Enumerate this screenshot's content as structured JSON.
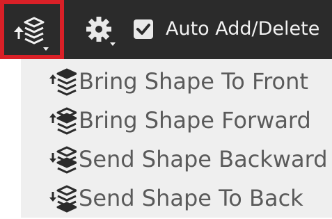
{
  "toolbar": {
    "layers_button_icon": "layers-arrange-icon",
    "settings_button_icon": "gear-icon",
    "auto_add_checkbox_checked": true,
    "auto_add_label": "Auto Add/Delete",
    "highlight_color": "#d92027",
    "background_color": "#2b2b2b"
  },
  "menu": {
    "items": [
      {
        "label": "Bring Shape To Front",
        "icon": "bring-to-front-icon"
      },
      {
        "label": "Bring Shape Forward",
        "icon": "bring-forward-icon"
      },
      {
        "label": "Send Shape Backward",
        "icon": "send-backward-icon"
      },
      {
        "label": "Send Shape To Back",
        "icon": "send-to-back-icon"
      }
    ]
  }
}
